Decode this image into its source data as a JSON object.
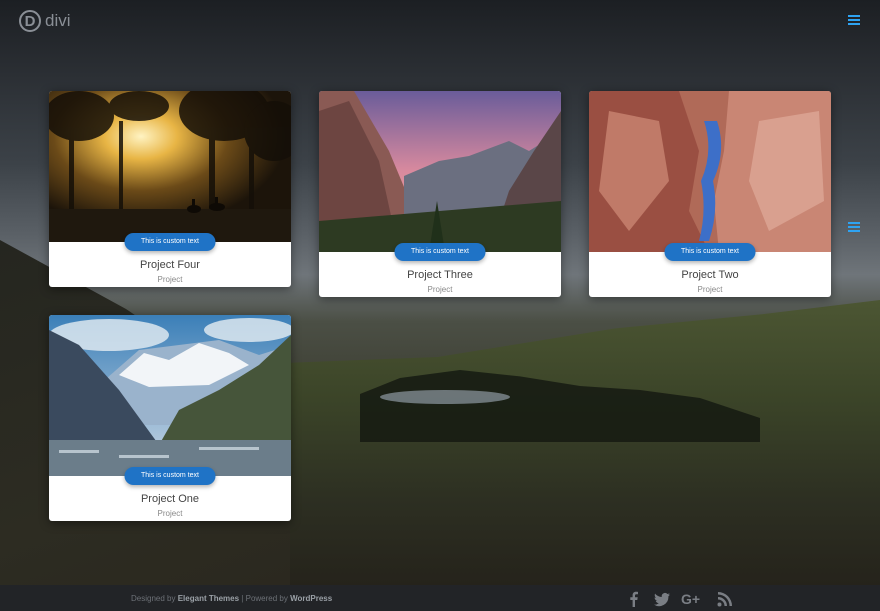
{
  "header": {
    "logo_letter": "D",
    "logo_text": "divi",
    "menu_icon": "hamburger-icon"
  },
  "projects": [
    {
      "title": "Project Four",
      "category": "Project",
      "button_text": "This is custom text",
      "image": "forest-sunrays-horses-photo"
    },
    {
      "title": "Project Three",
      "category": "Project",
      "button_text": "This is custom text",
      "image": "mountain-cliffs-sunset-photo"
    },
    {
      "title": "Project Two",
      "category": "Project",
      "button_text": "This is custom text",
      "image": "red-rock-canyon-river-photo"
    },
    {
      "title": "Project One",
      "category": "Project",
      "button_text": "This is custom text",
      "image": "snowy-mountains-lake-photo"
    }
  ],
  "footer": {
    "designed_by": "Designed by",
    "theme_name": "Elegant Themes",
    "separator": " | Powered by ",
    "platform": "WordPress",
    "social_icons": [
      "facebook-icon",
      "twitter-icon",
      "google-plus-icon",
      "rss-icon"
    ]
  },
  "colors": {
    "accent": "#2ea3f2",
    "button": "#1f73c6",
    "footer_bg": "#222427"
  }
}
